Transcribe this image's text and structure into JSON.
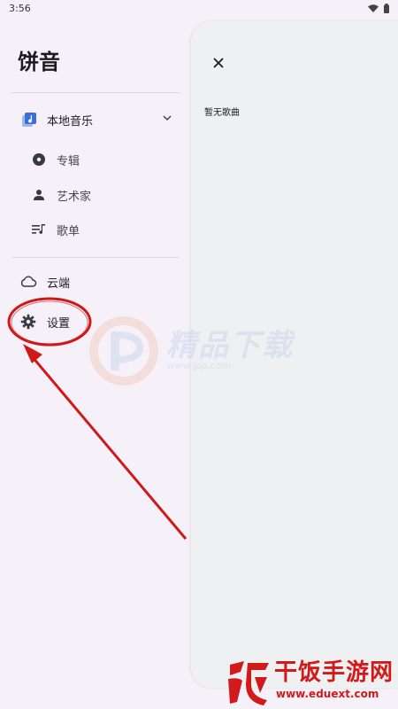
{
  "status_bar": {
    "time": "3:56"
  },
  "drawer": {
    "app_title": "饼音",
    "local_music": {
      "label": "本地音乐"
    },
    "sub_items": [
      {
        "label": "专辑",
        "icon": "album-icon"
      },
      {
        "label": "艺术家",
        "icon": "person-icon"
      },
      {
        "label": "歌单",
        "icon": "playlist-icon"
      }
    ],
    "cloud": {
      "label": "云端",
      "icon": "cloud-icon"
    },
    "settings": {
      "label": "设置",
      "icon": "gear-icon"
    }
  },
  "panel": {
    "empty_text": "暂无歌曲",
    "close_icon": "close-icon"
  },
  "watermark": {
    "text": "精品下载",
    "url": "www.jpp.com"
  },
  "brand": {
    "name": "干饭手游网",
    "url": "www.eduext.com"
  },
  "colors": {
    "annotation_red": "#d01818",
    "accent_blue": "#3a6fd8",
    "brand_red": "#d21a1a"
  }
}
